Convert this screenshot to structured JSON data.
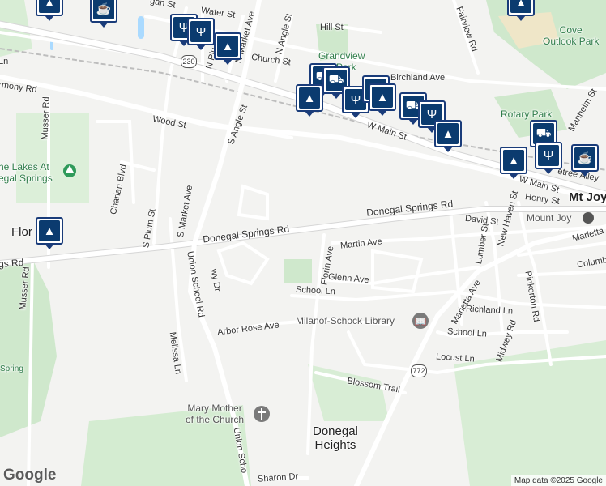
{
  "streets": {
    "water_st": "Water St",
    "gan_st": "gan St",
    "hill_st": "Hill St",
    "fairview_rd": "Fairview Rd",
    "church_st": "Church St",
    "n_angle_st": "N Angle St",
    "n_market_ave": "N Market Ave",
    "n_plum": "N Plu",
    "harmony_rd": "rmony Rd",
    "birchland_ave": "Birchland Ave",
    "manheim_st": "Manheim St",
    "wood_st": "Wood St",
    "w_main_st": "W Main St",
    "w_main_st_2": "W Main St",
    "s_angle_st": "S Angle St",
    "musser_rd_n": "Musser Rd",
    "charlan_blvd": "Charlan Blvd",
    "s_market_ave": "S Market Ave",
    "s_plum_st": "S Plum St",
    "henry_st": "Henry St",
    "donegal_springs_rd": "Donegal Springs Rd",
    "donegal_springs_rd_2": "Donegal Springs Rd",
    "springs_rd": "gs Rd",
    "david_st": "David St",
    "lumber_st": "Lumber St",
    "new_haven_st": "New Haven St",
    "marietta": "Marietta",
    "columbia": "Columbi",
    "martin_ave": "Martin Ave",
    "florin_ave": "Florin Ave",
    "union_school_rd": "Union School Rd",
    "wy_dr": "wy Dr",
    "pinkerton_rd": "Pinkerton Rd",
    "glenn_ave": "Glenn Ave",
    "school_ln": "School Ln",
    "marietta_ave": "Marietta Ave",
    "richland_ln": "Richland Ln",
    "musser_rd_s": "Musser Rd",
    "arbor_rose_ave": "Arbor Rose Ave",
    "school_ln_2": "School Ln",
    "midway_rd": "Midway Rd",
    "melissa_ln": "Melissa Ln",
    "locust_ln": "Locust Ln",
    "blossom_trail": "Blossom Trail",
    "union_sch": "Union Scho",
    "sharon_dr": "Sharon Dr",
    "ln": "Ln",
    "e_alley": "etree Alley"
  },
  "places": {
    "cove_outlook_park": "Cove\nOutlook Park",
    "grandview": "Grandview",
    "park": "Park",
    "rotary_park": "Rotary Park",
    "lakes_at_donegal": "he Lakes At\negal Springs",
    "mt_joy": "Mt Joy",
    "mount_joy": "Mount Joy",
    "flor": "Flor",
    "library": "Milanof-Schock Library",
    "church": "Mary Mother\nof the Church",
    "donegal_heights": "Donegal\nHeights",
    "spring": "Spring"
  },
  "route_shields": {
    "r230": "230",
    "r772": "772"
  },
  "markers": [
    {
      "icon": "coffee-icon",
      "glyph": "☕"
    },
    {
      "icon": "restaurant-icon",
      "glyph": "🍴"
    },
    {
      "icon": "shopping-bag-icon",
      "glyph": "👜"
    },
    {
      "icon": "shopping-cart-icon",
      "glyph": "🛒"
    }
  ],
  "branding": {
    "logo": "Google",
    "credit": "Map data ©2025 Google"
  }
}
